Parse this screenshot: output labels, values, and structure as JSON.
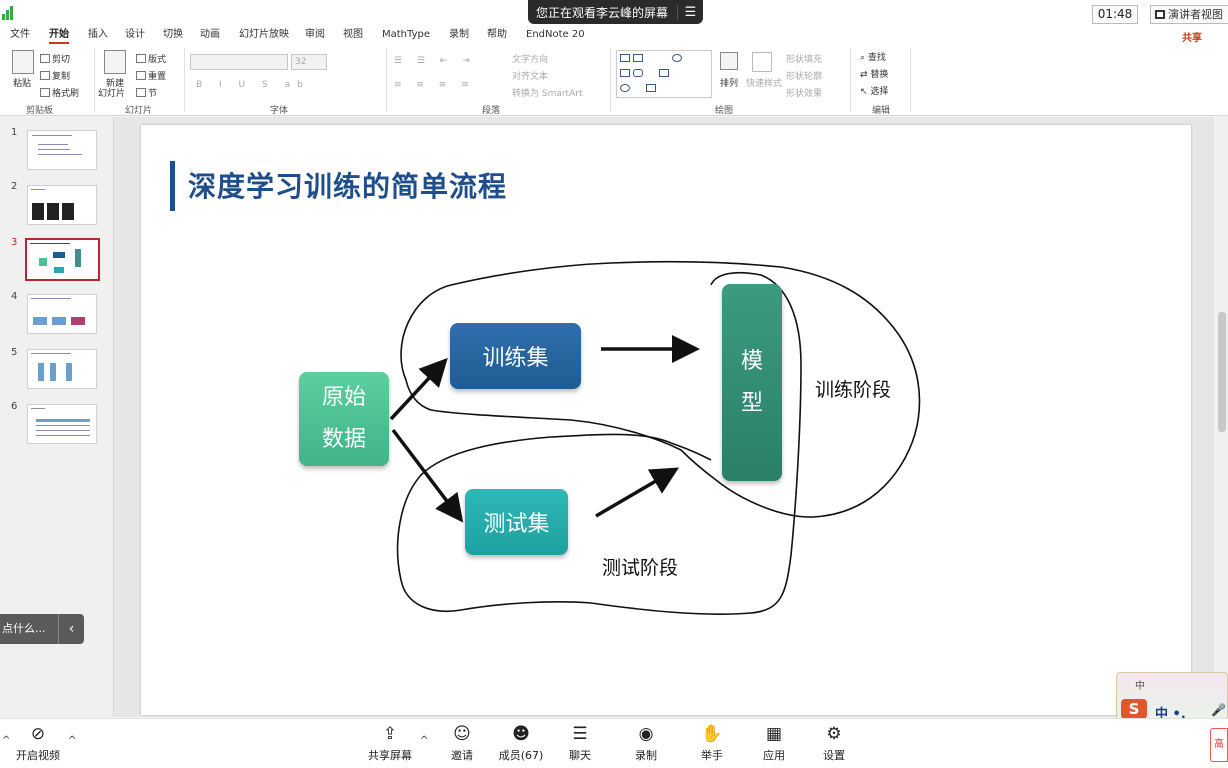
{
  "top": {
    "banner_text": "您正在观看李云峰的屏幕",
    "banner_menu": "☰",
    "timer": "01:48",
    "presenter_view": "演讲者视图"
  },
  "ribbon": {
    "tabs": [
      "文件",
      "开始",
      "插入",
      "设计",
      "切换",
      "动画",
      "幻灯片放映",
      "审阅",
      "视图",
      "MathType",
      "录制",
      "帮助",
      "EndNote 20"
    ],
    "share": "共享",
    "clipboard": {
      "paste": "粘贴",
      "cut": "剪切",
      "copy": "复制",
      "format_painter": "格式刷",
      "label": "剪贴板"
    },
    "slides": {
      "new_slide": "新建",
      "new_slide2": "幻灯片",
      "layout": "版式",
      "reset": "重置",
      "section": "节",
      "label": "幻灯片"
    },
    "font": {
      "label": "字体",
      "size": "32"
    },
    "paragraph": {
      "text_direction": "文字方向",
      "align_text": "对齐文本",
      "convert_smartart": "转换为 SmartArt",
      "label": "段落"
    },
    "drawing": {
      "arrange": "排列",
      "quick_styles": "快速样式",
      "shape_fill": "形状填充",
      "shape_outline": "形状轮廓",
      "shape_effects": "形状效果",
      "label": "绘图"
    },
    "editing": {
      "find": "查找",
      "replace": "替换",
      "select": "选择",
      "label": "编辑"
    }
  },
  "thumbnails": [
    {
      "num": "1"
    },
    {
      "num": "2"
    },
    {
      "num": "3"
    },
    {
      "num": "4"
    },
    {
      "num": "5"
    },
    {
      "num": "6"
    }
  ],
  "tooltip": {
    "text": "点什么...",
    "chevron": "‹"
  },
  "slide": {
    "title": "深度学习训练的简单流程",
    "raw_line1": "原始",
    "raw_line2": "数据",
    "train_set": "训练集",
    "test_set": "测试集",
    "model_line1": "模",
    "model_line2": "型",
    "stage_train": "训练阶段",
    "stage_test": "测试阶段"
  },
  "ime": {
    "logo": "S",
    "mode": "中 •,",
    "small": "中",
    "mic": "🎤"
  },
  "meeting": {
    "video": "开启视频",
    "share_screen": "共享屏幕",
    "invite": "邀请",
    "members": "成员(67)",
    "chat": "聊天",
    "record": "录制",
    "raise_hand": "举手",
    "apps": "应用",
    "settings": "设置",
    "red_chip": "高"
  },
  "colors": {
    "accent": "#c43e1c",
    "title_blue": "#1f4e8c",
    "thumb_active": "#b5282e"
  }
}
